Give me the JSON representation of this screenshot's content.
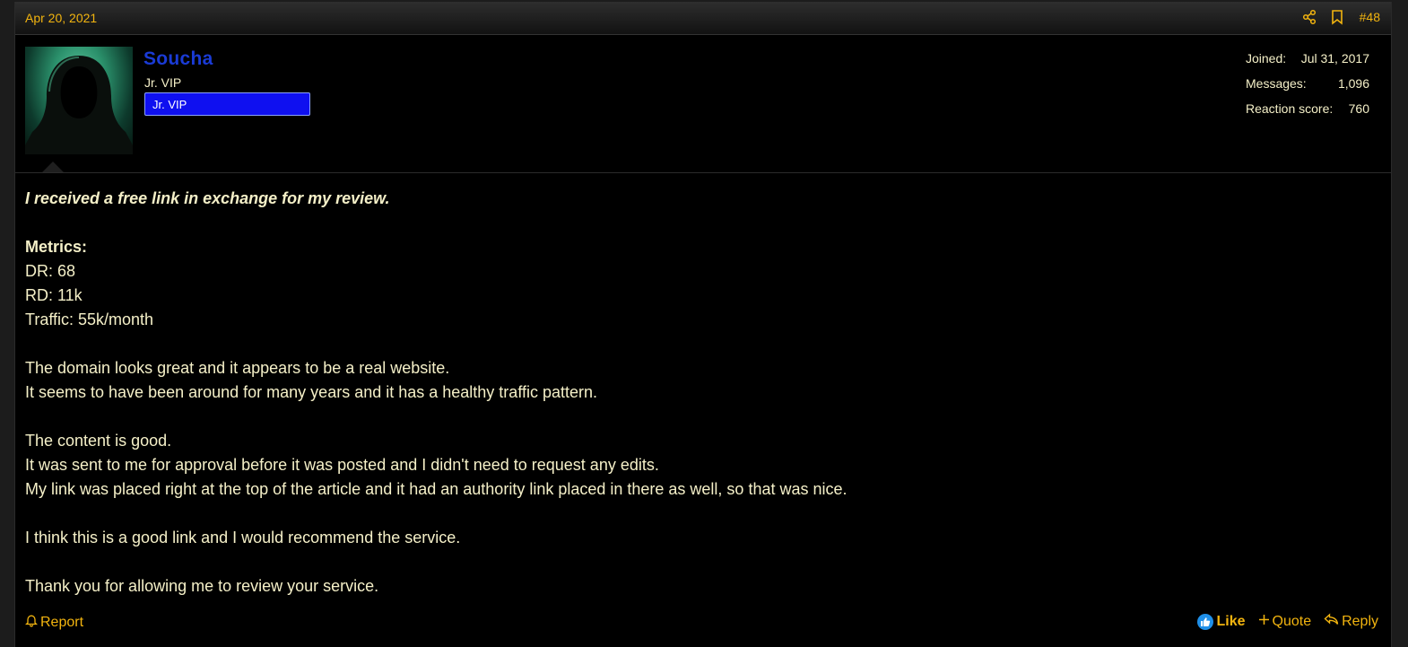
{
  "post": {
    "date": "Apr 20, 2021",
    "number": "#48"
  },
  "user": {
    "name": "Soucha",
    "title": "Jr. VIP",
    "banner": "Jr. VIP",
    "stats": [
      {
        "label": "Joined:",
        "value": "Jul 31, 2017"
      },
      {
        "label": "Messages:",
        "value": "1,096"
      },
      {
        "label": "Reaction score:",
        "value": "760"
      }
    ]
  },
  "content": {
    "disclosure": "I received a free link in exchange for my review.",
    "metrics_heading": "Metrics:",
    "metrics": [
      "DR: 68",
      "RD: 11k",
      "Traffic: 55k/month"
    ],
    "para1": [
      "The domain looks great and it appears to be a real website.",
      "It seems to have been around for many years and it has a healthy traffic pattern."
    ],
    "para2": [
      "The content is good.",
      "It was sent to me for approval before it was posted and I didn't need to request any edits.",
      "My link was placed right at the top of the article and it had an authority link placed in there as well, so that was nice."
    ],
    "para3": "I think this is a good link and I would recommend the service.",
    "para4": "Thank you for allowing me to review your service."
  },
  "footer": {
    "report": "Report",
    "like": "Like",
    "quote": "Quote",
    "reply": "Reply"
  },
  "icons": {
    "share": "share-icon",
    "bookmark": "bookmark-icon",
    "bell": "bell-icon",
    "thumb": "thumbs-up-icon",
    "plus": "plus-icon",
    "reply": "reply-arrow-icon"
  },
  "colors": {
    "accent": "#f2b40f",
    "username": "#1a3bd6",
    "banner": "#0f10f0",
    "text": "#f5f0c8",
    "like": "#1f8fe8"
  }
}
